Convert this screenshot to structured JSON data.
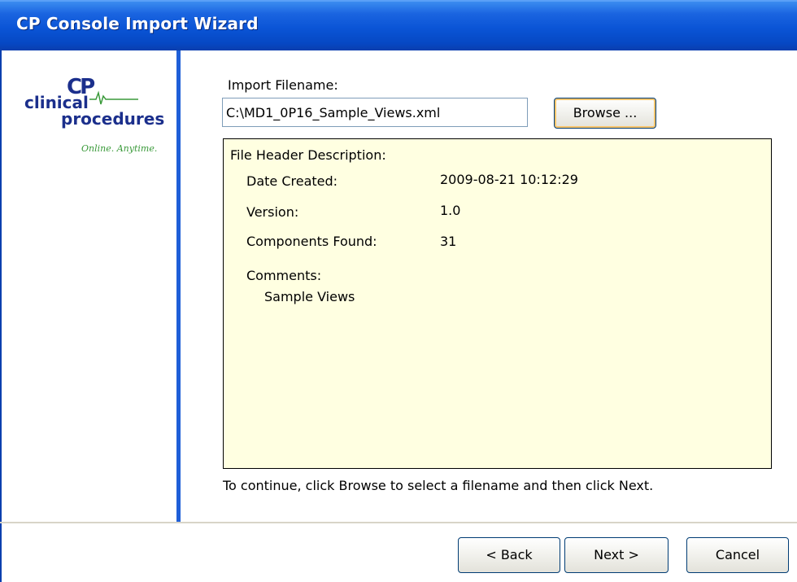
{
  "window": {
    "title": "CP Console Import Wizard"
  },
  "logo": {
    "mark": "CP",
    "line1": "clinical",
    "line2": "procedures",
    "tagline": "Online. Anytime."
  },
  "import": {
    "label": "Import Filename:",
    "value": "C:\\MD1_0P16_Sample_Views.xml",
    "browse_label": "Browse ..."
  },
  "header": {
    "title": "File Header Description:",
    "date_label": "Date Created:",
    "date_value": "2009-08-21 10:12:29",
    "version_label": "Version:",
    "version_value": "1.0",
    "components_label": "Components Found:",
    "components_value": "31",
    "comments_label": "Comments:",
    "comments_value": "Sample Views"
  },
  "hint": "To continue, click Browse to select a filename and then click Next.",
  "buttons": {
    "back": "< Back",
    "next": "Next >",
    "cancel": "Cancel"
  }
}
